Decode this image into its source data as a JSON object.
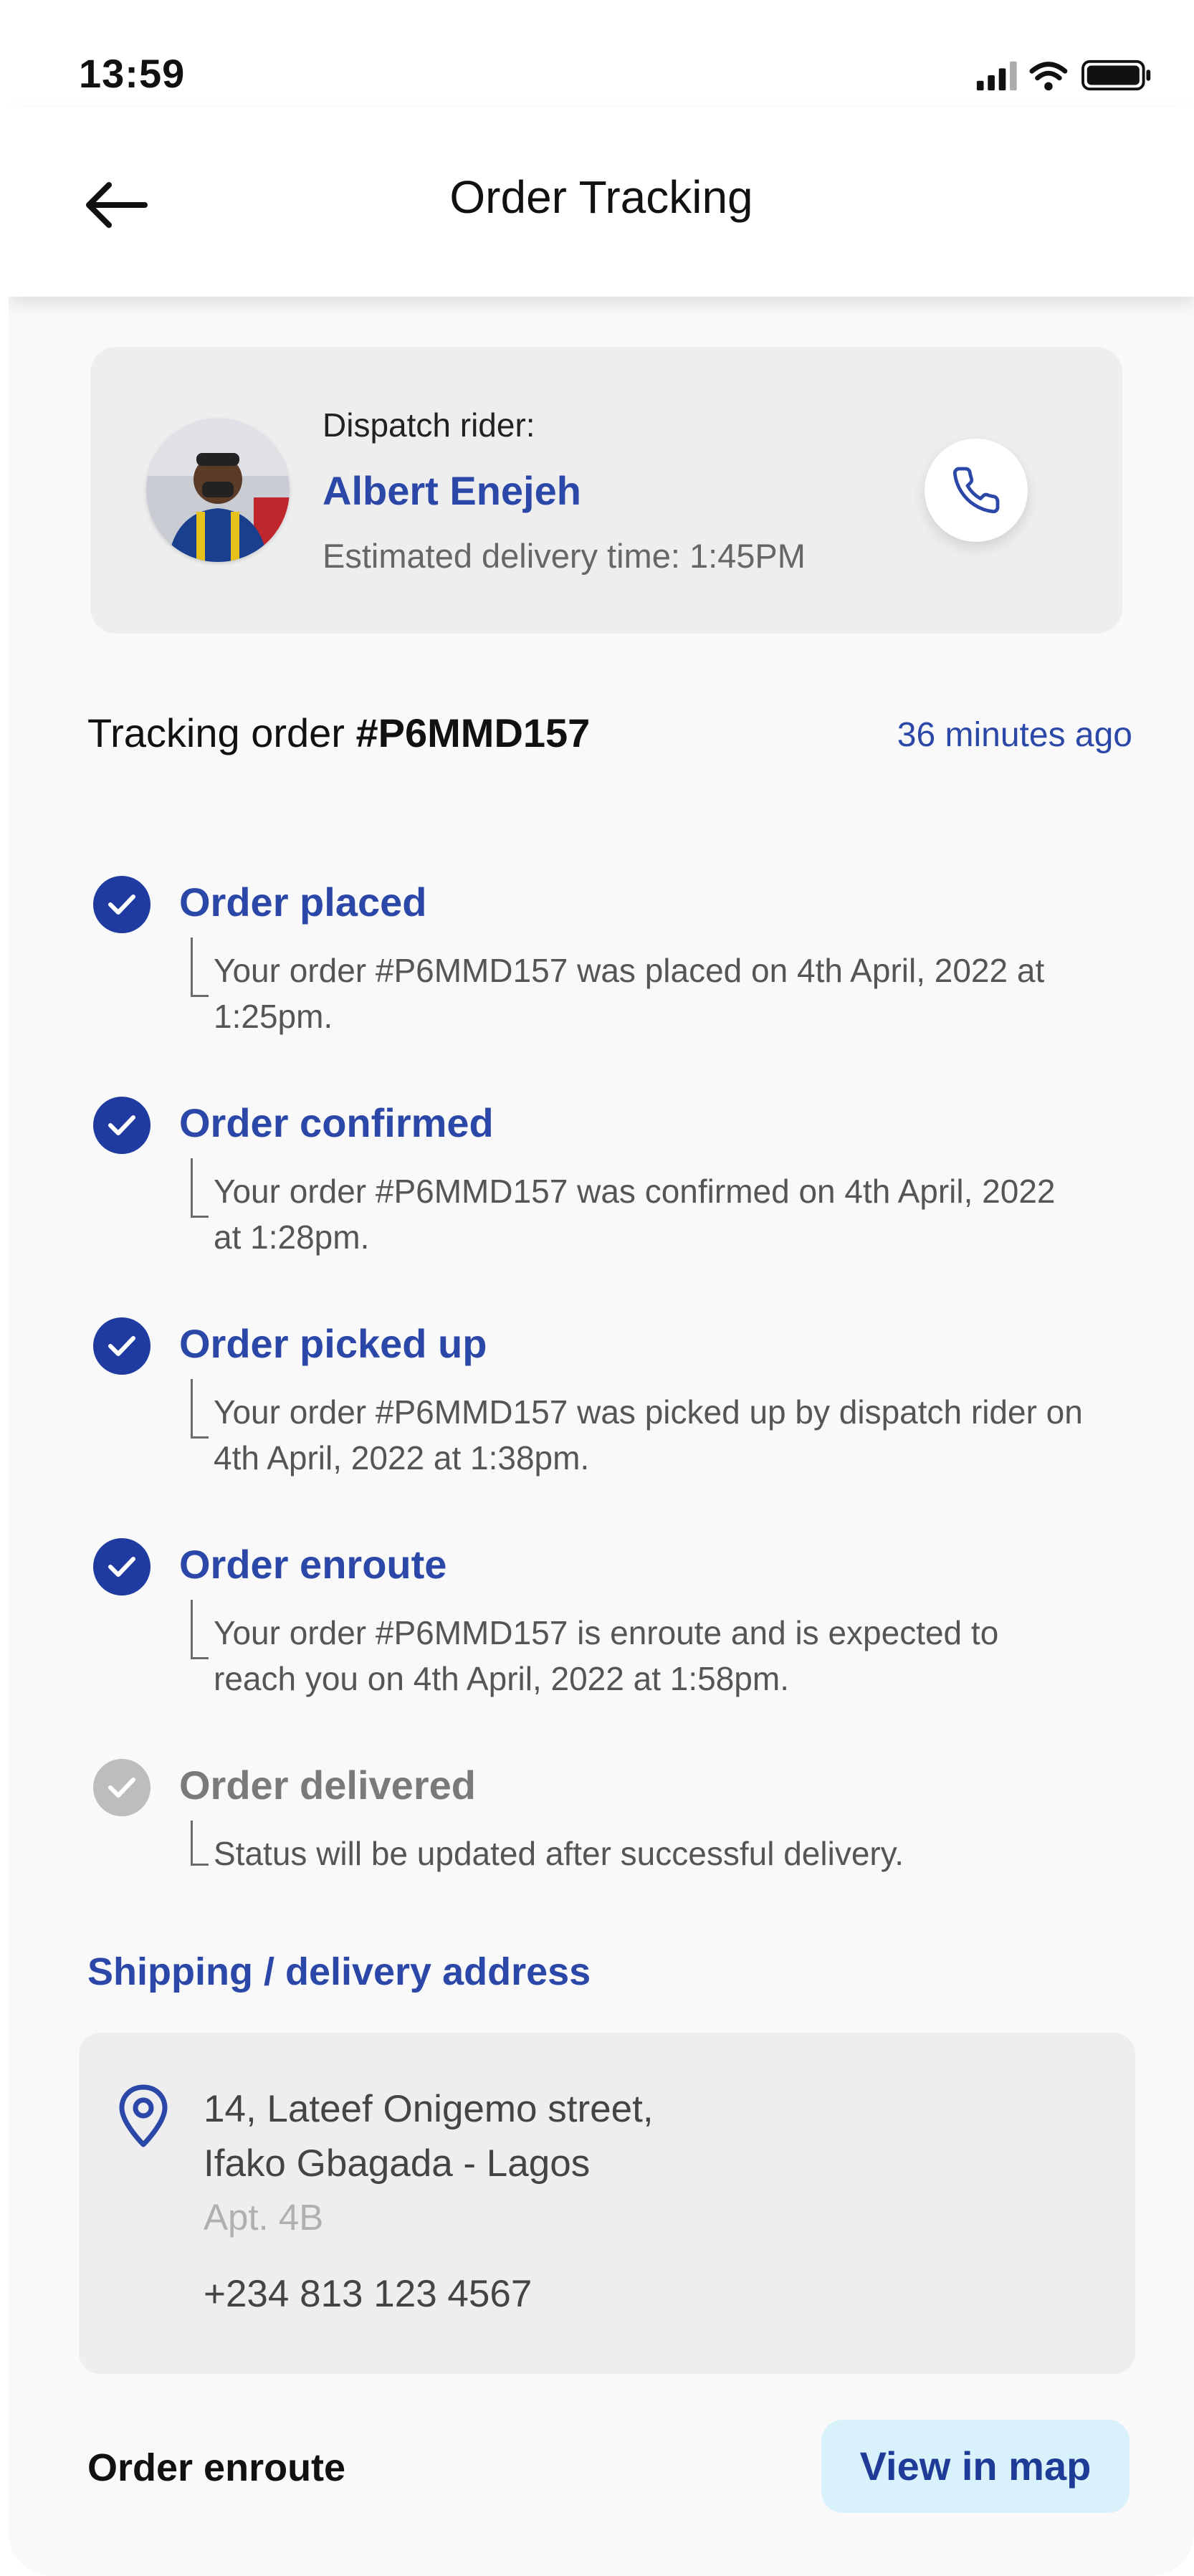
{
  "status_bar": {
    "time": "13:59"
  },
  "header": {
    "title": "Order Tracking"
  },
  "rider": {
    "caption": "Dispatch rider:",
    "name": "Albert Enejeh",
    "eta": "Estimated delivery time: 1:45PM"
  },
  "tracking": {
    "label": "Tracking order ",
    "order_id": "#P6MMD157",
    "time_ago": "36 minutes ago"
  },
  "steps": [
    {
      "title": "Order placed",
      "desc": "Your order #P6MMD157 was placed on 4th April, 2022 at 1:25pm.",
      "state": "done"
    },
    {
      "title": "Order confirmed",
      "desc": "Your order #P6MMD157 was confirmed on 4th April, 2022 at 1:28pm.",
      "state": "done"
    },
    {
      "title": "Order picked up",
      "desc": "Your order #P6MMD157 was picked up by dispatch rider on 4th April, 2022 at 1:38pm.",
      "state": "done"
    },
    {
      "title": "Order enroute",
      "desc": "Your order #P6MMD157 is enroute and is expected to reach you on 4th April, 2022 at 1:58pm.",
      "state": "done"
    },
    {
      "title": "Order delivered",
      "desc": "Status will be updated after successful delivery.",
      "state": "pending"
    }
  ],
  "shipping": {
    "title": "Shipping / delivery address",
    "line1": "14, Lateef Onigemo street,",
    "line2": "Ifako Gbagada - Lagos",
    "line3": "Apt. 4B",
    "phone": "+234 813 123 4567"
  },
  "footer": {
    "status": "Order enroute",
    "map_button": "View in map"
  },
  "colors": {
    "accent": "#2b47a8",
    "check_done": "#1f3aa0",
    "check_pending": "#bdbdbd",
    "map_button_bg": "#d8f1fa"
  },
  "icons": [
    "signal-icon",
    "wifi-icon",
    "battery-icon",
    "back-arrow-icon",
    "phone-icon",
    "check-icon",
    "location-pin-icon"
  ]
}
